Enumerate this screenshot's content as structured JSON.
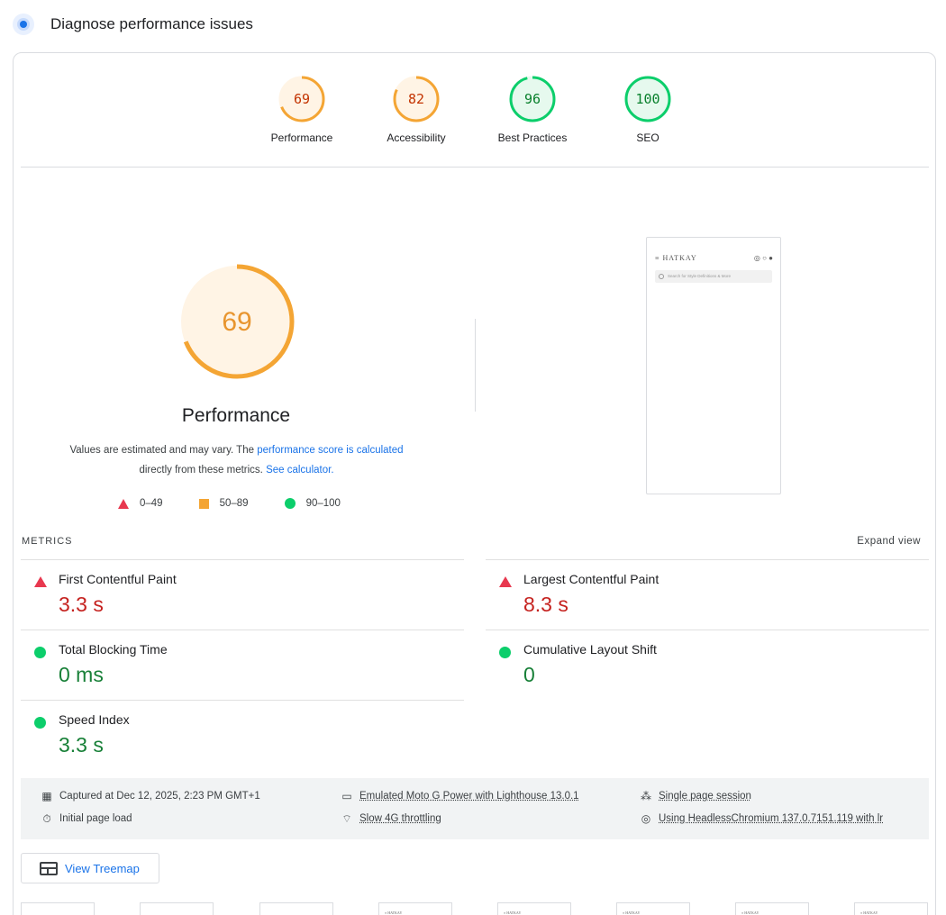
{
  "header": {
    "title": "Diagnose performance issues",
    "icon": "lighthouse-icon"
  },
  "categories": [
    {
      "score": "69",
      "label": "Performance",
      "value": 69,
      "color": "#f4a534",
      "bg": "#fff4e5",
      "text": "#c33300"
    },
    {
      "score": "82",
      "label": "Accessibility",
      "value": 82,
      "color": "#f4a534",
      "bg": "#fff4e5",
      "text": "#c33300"
    },
    {
      "score": "96",
      "label": "Best Practices",
      "value": 96,
      "color": "#0cce6b",
      "bg": "#e6f9ee",
      "text": "#08802c"
    },
    {
      "score": "100",
      "label": "SEO",
      "value": 100,
      "color": "#0cce6b",
      "bg": "#e6f9ee",
      "text": "#08802c"
    }
  ],
  "performance": {
    "score": "69",
    "value": 69,
    "title": "Performance",
    "desc_part1": "Values are estimated and may vary. The ",
    "desc_link1": "performance score is calculated",
    "desc_part2": "directly from these metrics. ",
    "desc_link2": "See calculator."
  },
  "legend": {
    "poor": "0–49",
    "average": "50–89",
    "good": "90–100"
  },
  "screenshot": {
    "brand": "≡ HATKAY",
    "icons": "◎ ○ ●",
    "search_placeholder": "Search for Style Definitions & More"
  },
  "metrics": {
    "header": "METRICS",
    "expand": "Expand view",
    "fcp": {
      "name": "First Contentful Paint",
      "value": "3.3 s",
      "status": "poor"
    },
    "lcp": {
      "name": "Largest Contentful Paint",
      "value": "8.3 s",
      "status": "poor"
    },
    "tbt": {
      "name": "Total Blocking Time",
      "value": "0 ms",
      "status": "good"
    },
    "cls": {
      "name": "Cumulative Layout Shift",
      "value": "0",
      "status": "good"
    },
    "si": {
      "name": "Speed Index",
      "value": "3.3 s",
      "status": "good"
    }
  },
  "runtime": {
    "captured": "Captured at Dec 12, 2025, 2:23 PM GMT+1",
    "initial_load": "Initial page load",
    "device": "Emulated Moto G Power with Lighthouse 13.0.1",
    "throttling": "Slow 4G throttling",
    "session": "Single page session",
    "browser": "Using HeadlessChromium 137.0.7151.119 with lr"
  },
  "treemap": {
    "label": "View Treemap"
  },
  "filmstrip": {
    "frame_text": "≡ HATKAY"
  },
  "colors": {
    "accent": "#1a73e8",
    "poor": "#e8384f",
    "average": "#f4a534",
    "good": "#0cce6b"
  }
}
